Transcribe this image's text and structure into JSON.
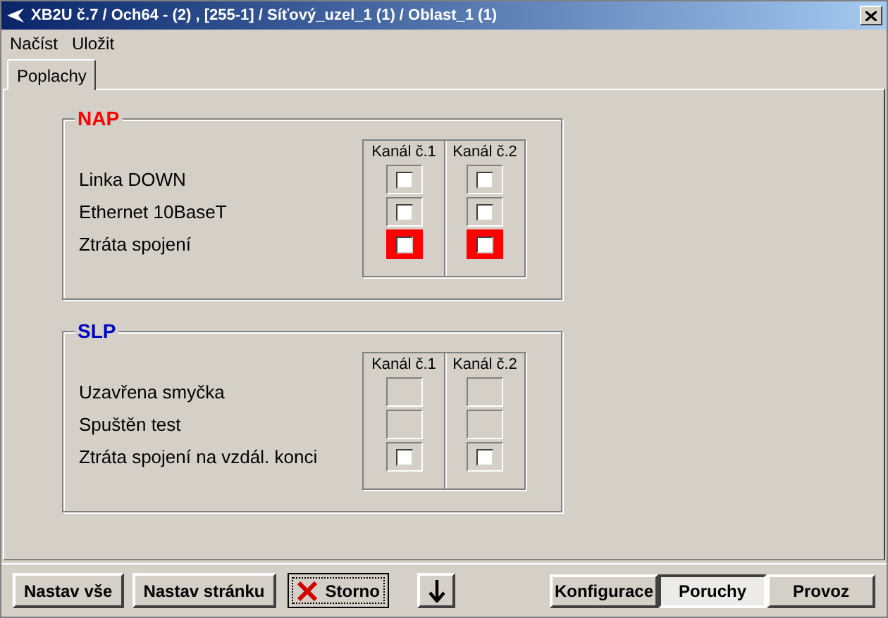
{
  "window": {
    "title": "XB2U č.7 / Och64 - (2) , [255-1] / Síťový_uzel_1 (1) / Oblast_1 (1)"
  },
  "menu": [
    "Načíst",
    "Uložit"
  ],
  "tabs": [
    {
      "label": "Poplachy",
      "selected": true
    }
  ],
  "groups": [
    {
      "title": "NAP",
      "color": "#ff0000",
      "columns": [
        "Kanál č.1",
        "Kanál č.2"
      ],
      "rows": [
        {
          "label": "Linka DOWN",
          "cells": [
            {
              "kind": "checkbox",
              "checked": false
            },
            {
              "kind": "checkbox",
              "checked": false
            }
          ]
        },
        {
          "label": "Ethernet 10BaseT",
          "cells": [
            {
              "kind": "checkbox",
              "checked": false
            },
            {
              "kind": "checkbox",
              "checked": false
            }
          ]
        },
        {
          "label": "Ztráta spojení",
          "cells": [
            {
              "kind": "alarm",
              "checked": false
            },
            {
              "kind": "alarm",
              "checked": false
            }
          ]
        }
      ]
    },
    {
      "title": "SLP",
      "color": "#0000c0",
      "columns": [
        "Kanál č.1",
        "Kanál č.2"
      ],
      "rows": [
        {
          "label": "Uzavřena smyčka",
          "cells": [
            {
              "kind": "empty"
            },
            {
              "kind": "empty"
            }
          ]
        },
        {
          "label": "Spuštěn test",
          "cells": [
            {
              "kind": "empty"
            },
            {
              "kind": "empty"
            }
          ]
        },
        {
          "label": "Ztráta spojení na vzdál. konci",
          "cells": [
            {
              "kind": "checkbox",
              "checked": false
            },
            {
              "kind": "checkbox",
              "checked": false
            }
          ]
        }
      ]
    }
  ],
  "actions": [
    {
      "label": "Nastav vše",
      "kind": "text"
    },
    {
      "label": "Nastav stránku",
      "kind": "text"
    },
    {
      "label": "Storno",
      "kind": "cancel"
    },
    {
      "kind": "down"
    }
  ],
  "views": [
    {
      "label": "Konfigurace",
      "selected": false
    },
    {
      "label": "Poruchy",
      "selected": true
    },
    {
      "label": "Provoz",
      "selected": false
    }
  ]
}
